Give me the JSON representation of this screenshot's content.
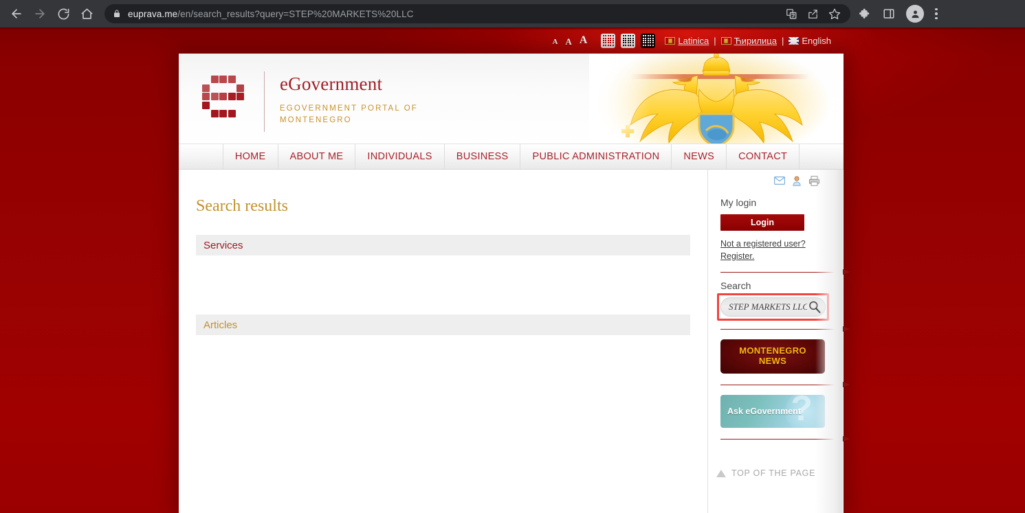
{
  "browser": {
    "url_host": "euprava.me",
    "url_path": "/en/search_results?query=STEP%20MARKETS%20LLC",
    "back_icon": "back-arrow-icon",
    "forward_icon": "forward-arrow-icon",
    "reload_icon": "reload-icon",
    "home_icon": "home-icon",
    "lock_icon": "lock-icon",
    "translate_icon": "translate-icon",
    "share_icon": "share-icon",
    "bookmark_icon": "star-icon",
    "extensions_icon": "puzzle-icon",
    "sidepanel_icon": "side-panel-icon",
    "profile_icon": "profile-avatar-icon",
    "menu_icon": "kebab-menu-icon"
  },
  "utility_bar": {
    "font_sizes": [
      "A",
      "A",
      "A"
    ],
    "contrast_options": [
      "contrast-red-on-white",
      "contrast-black-on-white",
      "contrast-white-on-black"
    ],
    "languages": [
      {
        "label": "Latinica",
        "flag": "montenegro-flag",
        "active": false
      },
      {
        "label": "Ћирилица",
        "flag": "montenegro-flag",
        "active": false
      },
      {
        "label": "English",
        "flag": "uk-flag",
        "active": true
      }
    ],
    "separator": "|"
  },
  "header": {
    "logo_title": "eGovernment",
    "logo_subtitle": "eGOVERNMENT PORTAL OF MONTENEGRO",
    "emblem": "montenegro-coat-of-arms-eagle",
    "brand_red": "#9f1f26",
    "brand_gold": "#c8922a"
  },
  "nav": {
    "items": [
      {
        "label": "HOME"
      },
      {
        "label": "ABOUT ME"
      },
      {
        "label": "INDIVIDUALS"
      },
      {
        "label": "BUSINESS"
      },
      {
        "label": "PUBLIC ADMINISTRATION"
      },
      {
        "label": "NEWS"
      },
      {
        "label": "CONTACT"
      }
    ]
  },
  "main": {
    "page_title": "Search results",
    "sections": [
      {
        "heading": "Services",
        "color": "#9b1b20",
        "results": []
      },
      {
        "heading": "Articles",
        "color": "#c2912f",
        "results": []
      }
    ]
  },
  "sidebar": {
    "tool_icons": [
      "mail-icon",
      "user-icon",
      "print-icon"
    ],
    "login": {
      "heading": "My login",
      "button_label": "Login",
      "register_line1": "Not a registered user?",
      "register_line2": "Register."
    },
    "search": {
      "heading": "Search",
      "value": "STEP MARKETS LLC",
      "placeholder": "Search",
      "icon": "magnifier-icon",
      "highlighted": true,
      "highlight_color": "#f4423c"
    },
    "banners": [
      {
        "id": "montenegro-news",
        "line1": "MONTENEGRO",
        "line2": "NEWS"
      },
      {
        "id": "ask-egovernment",
        "line1": "Ask eGovernment"
      }
    ],
    "top_of_page": {
      "label": "TOP OF THE PAGE",
      "icon": "triangle-up-icon"
    }
  }
}
